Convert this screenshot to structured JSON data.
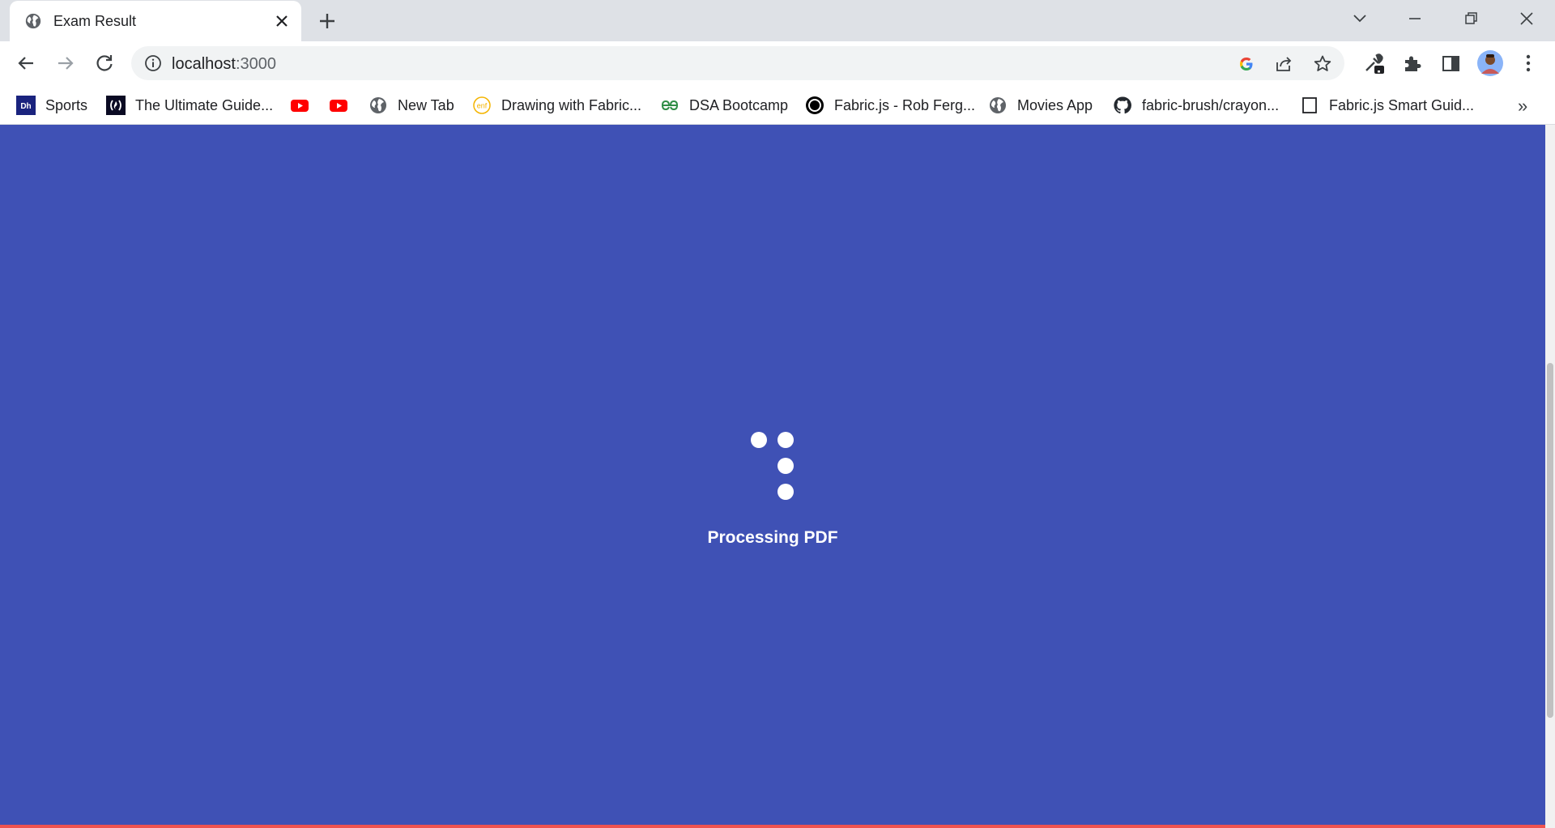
{
  "browser": {
    "tab": {
      "title": "Exam Result",
      "favicon": "globe-icon"
    },
    "address_bar": {
      "host": "localhost",
      "port": ":3000"
    },
    "bookmarks": [
      {
        "label": "Sports",
        "icon": "dh-logo-icon"
      },
      {
        "label": "The Ultimate Guide...",
        "icon": "freecodecamp-icon"
      },
      {
        "label": "",
        "icon": "youtube-icon"
      },
      {
        "label": "",
        "icon": "youtube-icon"
      },
      {
        "label": "New Tab",
        "icon": "globe-icon"
      },
      {
        "label": "Drawing with Fabric...",
        "icon": "enf-logo-icon"
      },
      {
        "label": "DSA Bootcamp",
        "icon": "geeksforgeeks-icon"
      },
      {
        "label": "Fabric.js - Rob Ferg...",
        "icon": "circle-logo-icon"
      },
      {
        "label": "Movies App",
        "icon": "globe-icon"
      },
      {
        "label": "fabric-brush/crayon...",
        "icon": "github-icon"
      },
      {
        "label": "Fabric.js Smart Guid...",
        "icon": "blank-page-icon"
      }
    ],
    "bookmarks_overflow": "»"
  },
  "page": {
    "background": "#3f51b5",
    "loader": {
      "label": "Processing PDF",
      "dot_color": "#ffffff"
    }
  }
}
